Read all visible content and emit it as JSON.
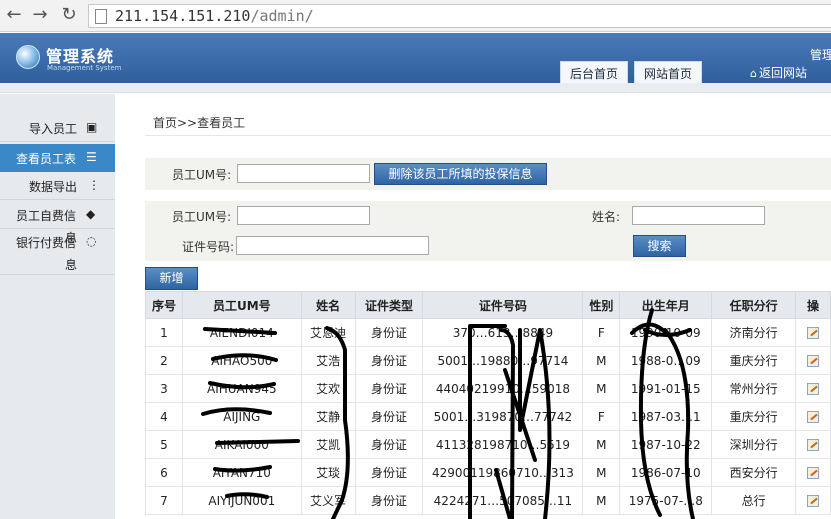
{
  "browser": {
    "back_icon": "arrow-left-icon",
    "forward_icon": "arrow-right-icon",
    "reload_icon": "reload-icon",
    "url_host": "211.154.151.210",
    "url_path": "/admin/"
  },
  "header": {
    "title": "管理系统",
    "subtitle": "Management System",
    "tabs": [
      {
        "label": "后台首页"
      },
      {
        "label": "网站首页"
      }
    ],
    "return_label": "返回网站",
    "admin_partial": "管理"
  },
  "sidebar": {
    "items": [
      {
        "label": "导入员工",
        "icon": "document-icon"
      },
      {
        "label": "查看员工表",
        "icon": "table-icon",
        "active": true
      },
      {
        "label": "数据导出",
        "icon": "dots-icon"
      },
      {
        "label": "员工自费信息",
        "line1": "员工自费信",
        "line2": "息",
        "icon": "tag-icon"
      },
      {
        "label": "银行付费信息",
        "line1": "银行付费信",
        "line2": "息",
        "icon": "chat-icon"
      }
    ]
  },
  "breadcrumb": "首页>>查看员工",
  "delete_form": {
    "um_label": "员工UM号:",
    "um_value": "",
    "delete_button": "删除该员工所填的投保信息"
  },
  "search_form": {
    "um_label": "员工UM号:",
    "um_value": "",
    "name_label": "姓名:",
    "name_value": "",
    "id_label": "证件号码:",
    "id_value": "",
    "search_button": "搜索"
  },
  "add_button": "新增",
  "table": {
    "columns": [
      "序号",
      "员工UM号",
      "姓名",
      "证件类型",
      "证件号码",
      "性别",
      "出生年月",
      "任职分行",
      "操"
    ],
    "rows": [
      [
        "1",
        "AIENDI014",
        "艾恩迪",
        "身份证",
        "370…613…8849",
        "F",
        "1990-10-09",
        "济南分行"
      ],
      [
        "2",
        "AIHAO500",
        "艾浩",
        "身份证",
        "5001…19880…97714",
        "M",
        "1988-0…09",
        "重庆分行"
      ],
      [
        "3",
        "AIHUAN945",
        "艾欢",
        "身份证",
        "44040219910…59018",
        "M",
        "1991-01-15",
        "常州分行"
      ],
      [
        "4",
        "AIJING",
        "艾静",
        "身份证",
        "5001…319870…77742",
        "F",
        "1987-03…1",
        "重庆分行"
      ],
      [
        "5",
        "AIKAI000",
        "艾凯",
        "身份证",
        "411328198710…5519",
        "M",
        "1987-10-22",
        "深圳分行"
      ],
      [
        "6",
        "AIYAN710",
        "艾琰",
        "身份证",
        "42900119860710…313",
        "M",
        "1986-07-10",
        "西安分行"
      ],
      [
        "7",
        "AIYIJUN001",
        "艾义军",
        "身份证",
        "4224271…507085…11",
        "M",
        "1975-07-…8",
        "总行"
      ]
    ]
  }
}
